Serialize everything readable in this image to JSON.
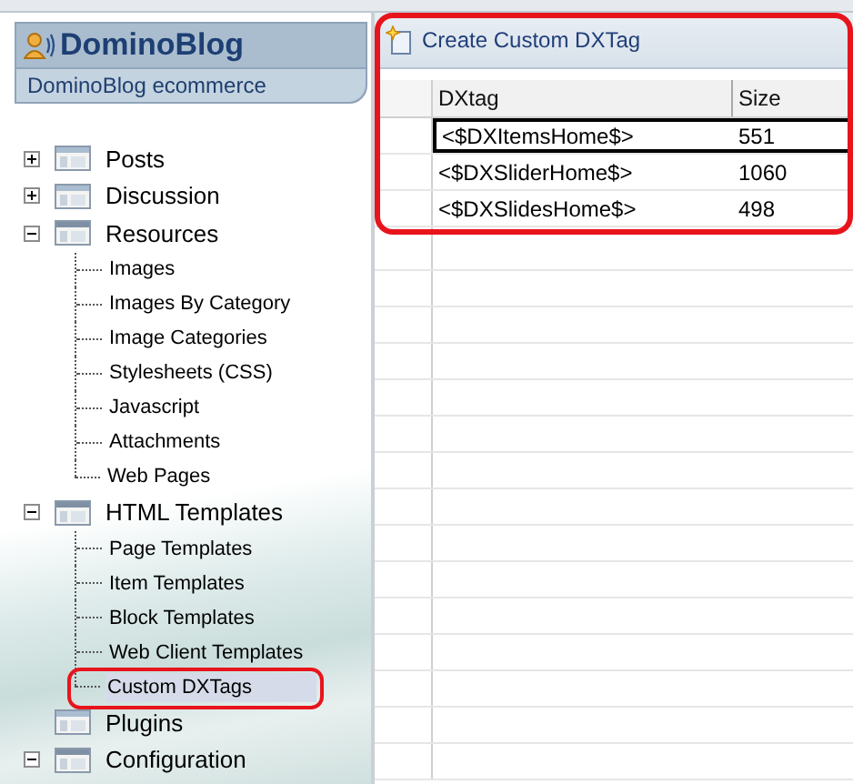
{
  "sidebar": {
    "title": "DominoBlog",
    "subtitle": "DominoBlog ecommerce",
    "tree": [
      {
        "label": "Posts",
        "expanded": false
      },
      {
        "label": "Discussion",
        "expanded": false
      },
      {
        "label": "Resources",
        "expanded": true,
        "children": [
          {
            "label": "Images",
            "selected": false,
            "annotated": false
          },
          {
            "label": "Images By Category",
            "selected": false,
            "annotated": false
          },
          {
            "label": "Image Categories",
            "selected": false,
            "annotated": false
          },
          {
            "label": "Stylesheets (CSS)",
            "selected": false,
            "annotated": false
          },
          {
            "label": "Javascript",
            "selected": false,
            "annotated": false
          },
          {
            "label": "Attachments",
            "selected": false,
            "annotated": false
          },
          {
            "label": "Web Pages",
            "selected": false,
            "annotated": false
          }
        ]
      },
      {
        "label": "HTML Templates",
        "expanded": true,
        "children": [
          {
            "label": "Page Templates",
            "selected": false,
            "annotated": false
          },
          {
            "label": "Item Templates",
            "selected": false,
            "annotated": false
          },
          {
            "label": "Block Templates",
            "selected": false,
            "annotated": false
          },
          {
            "label": "Web Client Templates",
            "selected": false,
            "annotated": false
          },
          {
            "label": "Custom DXTags",
            "selected": true,
            "annotated": true
          }
        ]
      },
      {
        "label": "Plugins"
      },
      {
        "label": "Configuration",
        "expanded": true
      }
    ]
  },
  "content": {
    "annotated": true,
    "toolbar": {
      "button": "Create Custom DXTag"
    },
    "table": {
      "columns": [
        "DXtag",
        "Size"
      ],
      "rows": [
        {
          "cells": [
            "<$DXItemsHome$>",
            "551"
          ],
          "selected": true
        },
        {
          "cells": [
            "<$DXSliderHome$>",
            "1060"
          ],
          "selected": false
        },
        {
          "cells": [
            "<$DXSlidesHome$>",
            "498"
          ],
          "selected": false
        }
      ]
    }
  }
}
